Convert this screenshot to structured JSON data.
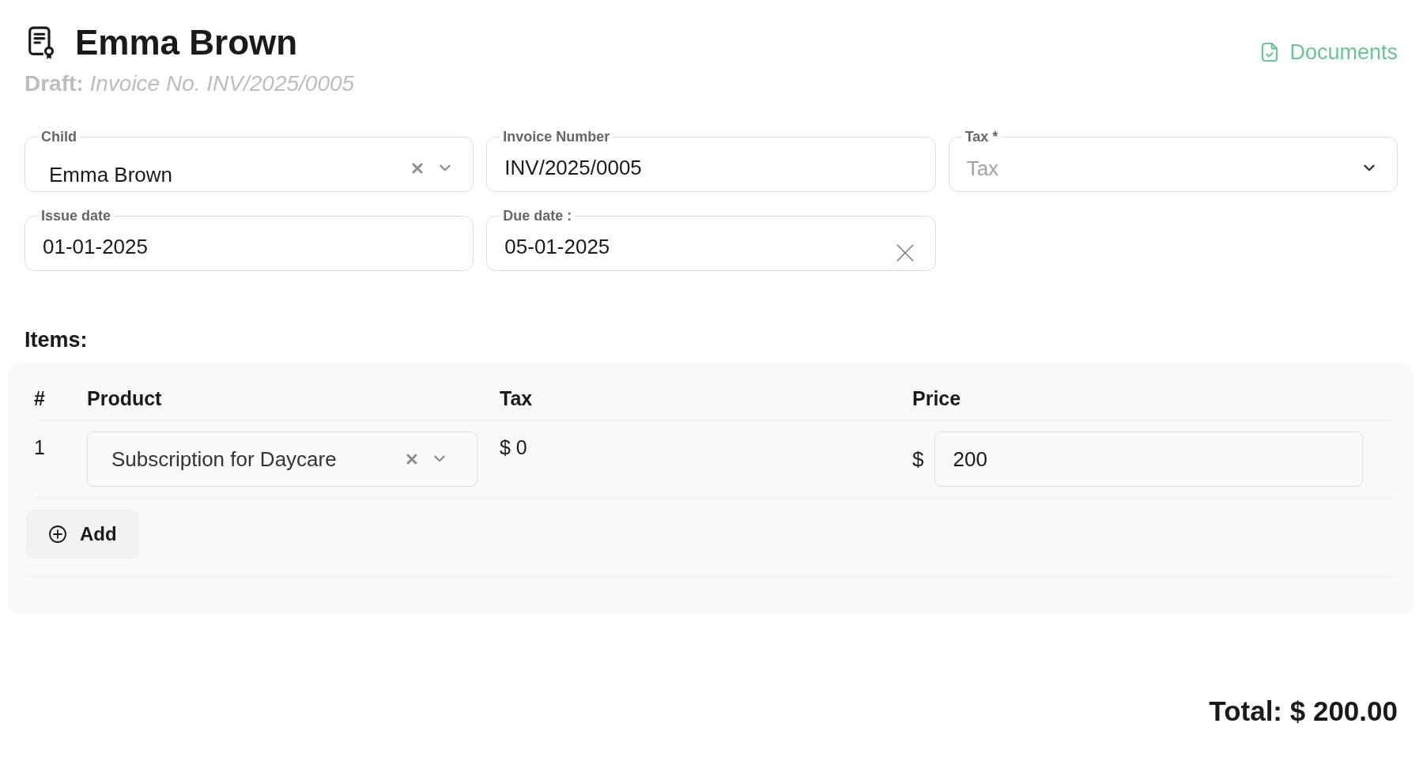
{
  "header": {
    "title": "Emma Brown",
    "subtitle": "**Draft:** *Invoice No. INV/2025/0005*",
    "documents_link": "Documents"
  },
  "fields": [
    {
      "kind": "select",
      "label": "Child",
      "value": "Emma Brown",
      "clearable": true
    },
    {
      "kind": "text",
      "label": "Invoice Number",
      "value": "INV/2025/0005"
    },
    {
      "kind": "select",
      "label": "Tax *",
      "placeholder": "Tax",
      "clearable": false
    },
    {
      "kind": "date",
      "label": "Issue date",
      "value": "01-01-2025",
      "clearable": false
    },
    {
      "kind": "date",
      "label": "Due date :",
      "value": "05-01-2025",
      "clearable": true
    }
  ],
  "items": {
    "heading": "Items:",
    "columns": [
      "#",
      "Product",
      "Tax",
      "Price"
    ],
    "rows": [
      {
        "index": "1",
        "product": "Subscription for Daycare",
        "tax": "$ 0",
        "currency": "$",
        "price": "200"
      }
    ],
    "add_button": "Add"
  },
  "total": "Total: $ 200.00"
}
